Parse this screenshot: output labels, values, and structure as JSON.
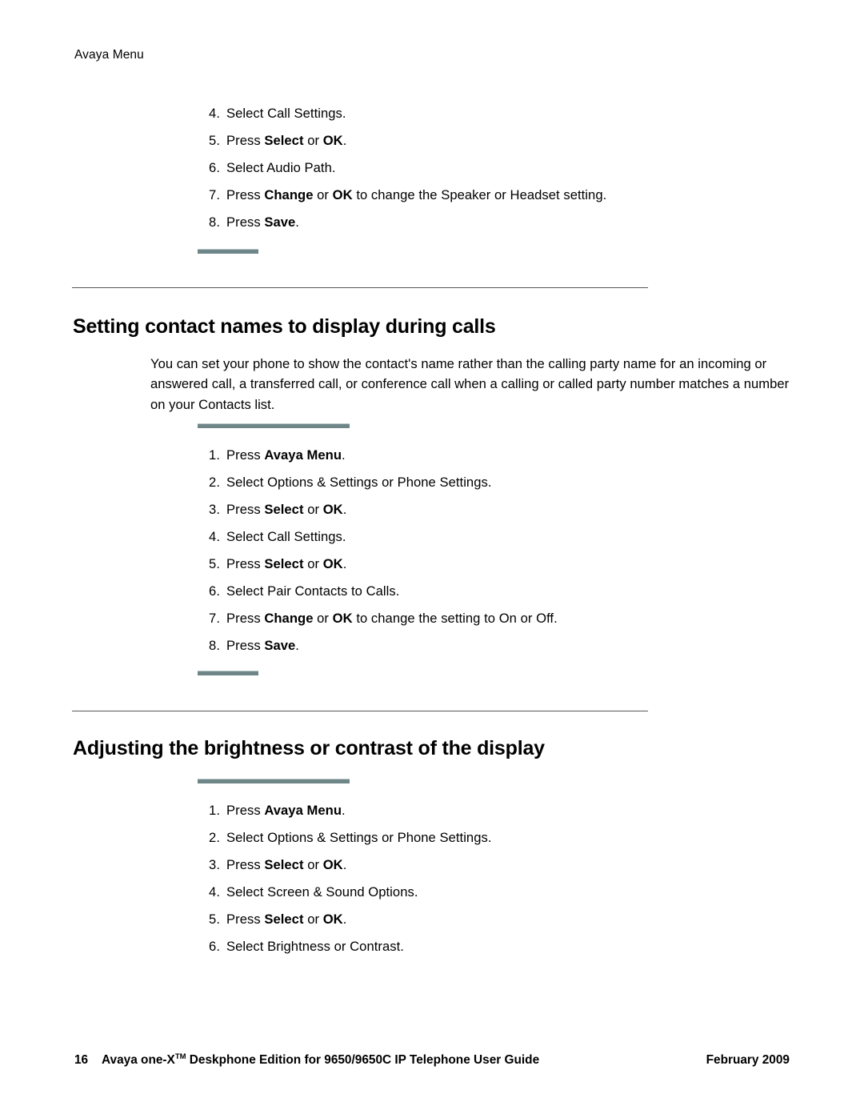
{
  "header": {
    "running_title": "Avaya Menu"
  },
  "sections": [
    {
      "id": "audio-path-continued",
      "list": [
        {
          "num": "4.",
          "parts": [
            {
              "t": "Select Call Settings.",
              "b": false
            }
          ]
        },
        {
          "num": "5.",
          "parts": [
            {
              "t": "Press ",
              "b": false
            },
            {
              "t": "Select",
              "b": true
            },
            {
              "t": " or ",
              "b": false
            },
            {
              "t": "OK",
              "b": true
            },
            {
              "t": ".",
              "b": false
            }
          ]
        },
        {
          "num": "6.",
          "parts": [
            {
              "t": "Select Audio Path.",
              "b": false
            }
          ]
        },
        {
          "num": "7.",
          "parts": [
            {
              "t": "Press ",
              "b": false
            },
            {
              "t": "Change",
              "b": true
            },
            {
              "t": " or ",
              "b": false
            },
            {
              "t": "OK",
              "b": true
            },
            {
              "t": " to change the Speaker or Headset setting.",
              "b": false
            }
          ]
        },
        {
          "num": "8.",
          "parts": [
            {
              "t": "Press ",
              "b": false
            },
            {
              "t": "Save",
              "b": true
            },
            {
              "t": ".",
              "b": false
            }
          ]
        }
      ]
    },
    {
      "id": "contact-names",
      "heading": "Setting contact names to display during calls",
      "paragraph": "You can set your phone to show the contact's name rather than the calling party name for an incoming or answered call, a transferred call, or conference call when a calling or called party number matches a number on your Contacts list.",
      "list": [
        {
          "num": "1.",
          "parts": [
            {
              "t": "Press ",
              "b": false
            },
            {
              "t": "Avaya Menu",
              "b": true
            },
            {
              "t": ".",
              "b": false
            }
          ]
        },
        {
          "num": "2.",
          "parts": [
            {
              "t": "Select Options & Settings or Phone Settings.",
              "b": false
            }
          ]
        },
        {
          "num": "3.",
          "parts": [
            {
              "t": "Press ",
              "b": false
            },
            {
              "t": "Select",
              "b": true
            },
            {
              "t": " or ",
              "b": false
            },
            {
              "t": "OK",
              "b": true
            },
            {
              "t": ".",
              "b": false
            }
          ]
        },
        {
          "num": "4.",
          "parts": [
            {
              "t": "Select Call Settings.",
              "b": false
            }
          ]
        },
        {
          "num": "5.",
          "parts": [
            {
              "t": "Press ",
              "b": false
            },
            {
              "t": "Select",
              "b": true
            },
            {
              "t": " or ",
              "b": false
            },
            {
              "t": "OK",
              "b": true
            },
            {
              "t": ".",
              "b": false
            }
          ]
        },
        {
          "num": "6.",
          "parts": [
            {
              "t": "Select Pair Contacts to Calls.",
              "b": false
            }
          ]
        },
        {
          "num": "7.",
          "parts": [
            {
              "t": "Press ",
              "b": false
            },
            {
              "t": "Change",
              "b": true
            },
            {
              "t": " or ",
              "b": false
            },
            {
              "t": "OK",
              "b": true
            },
            {
              "t": " to change the setting to On or Off.",
              "b": false
            }
          ]
        },
        {
          "num": "8.",
          "parts": [
            {
              "t": "Press ",
              "b": false
            },
            {
              "t": "Save",
              "b": true
            },
            {
              "t": ".",
              "b": false
            }
          ]
        }
      ]
    },
    {
      "id": "brightness-contrast",
      "heading": "Adjusting the brightness or contrast of the display",
      "list": [
        {
          "num": "1.",
          "parts": [
            {
              "t": "Press ",
              "b": false
            },
            {
              "t": "Avaya Menu",
              "b": true
            },
            {
              "t": ".",
              "b": false
            }
          ]
        },
        {
          "num": "2.",
          "parts": [
            {
              "t": "Select Options & Settings or Phone Settings.",
              "b": false
            }
          ]
        },
        {
          "num": "3.",
          "parts": [
            {
              "t": "Press ",
              "b": false
            },
            {
              "t": "Select",
              "b": true
            },
            {
              "t": " or ",
              "b": false
            },
            {
              "t": "OK",
              "b": true
            },
            {
              "t": ".",
              "b": false
            }
          ]
        },
        {
          "num": "4.",
          "parts": [
            {
              "t": "Select Screen & Sound Options.",
              "b": false
            }
          ]
        },
        {
          "num": "5.",
          "parts": [
            {
              "t": "Press ",
              "b": false
            },
            {
              "t": "Select",
              "b": true
            },
            {
              "t": " or ",
              "b": false
            },
            {
              "t": "OK",
              "b": true
            },
            {
              "t": ".",
              "b": false
            }
          ]
        },
        {
          "num": "6.",
          "parts": [
            {
              "t": "Select Brightness or Contrast.",
              "b": false
            }
          ]
        }
      ]
    }
  ],
  "footer": {
    "page_number": "16",
    "doc_title_before": "Avaya one-X",
    "doc_title_tm": "TM",
    "doc_title_after": " Deskphone Edition for 9650/9650C IP Telephone User Guide",
    "date": "February 2009"
  },
  "colors": {
    "teal_rule": "#6e8688",
    "head_rule": "#58585a",
    "text": "#000000",
    "page_background": "#ffffff"
  }
}
